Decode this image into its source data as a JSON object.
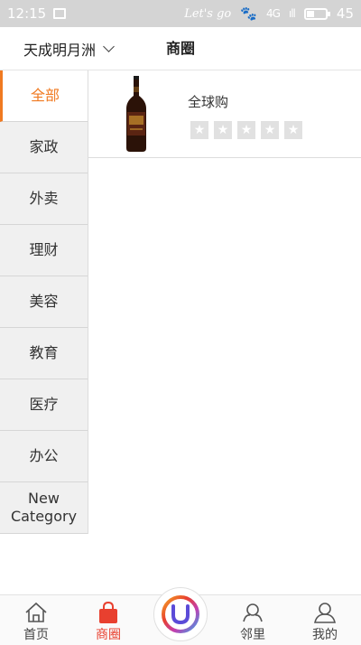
{
  "status_bar": {
    "time": "12:15",
    "carrier_sign": "Let's go",
    "signal_1": "4G",
    "signal_2": "ıll",
    "battery_level": "45",
    "battery_fraction": 0.45
  },
  "header": {
    "location": "天成明月洲",
    "title": "商圈"
  },
  "sidebar": {
    "items": [
      {
        "label": "全部",
        "active": true
      },
      {
        "label": "家政",
        "active": false
      },
      {
        "label": "外卖",
        "active": false
      },
      {
        "label": "理财",
        "active": false
      },
      {
        "label": "美容",
        "active": false
      },
      {
        "label": "教育",
        "active": false
      },
      {
        "label": "医疗",
        "active": false
      },
      {
        "label": "办公",
        "active": false
      },
      {
        "label": "New Category",
        "active": false
      }
    ]
  },
  "list": {
    "items": [
      {
        "name": "全球购",
        "image": "beer-bottle",
        "rating": 0,
        "rating_max": 5
      }
    ]
  },
  "tabbar": {
    "tabs": [
      {
        "label": "首页",
        "icon": "home-icon",
        "active": false
      },
      {
        "label": "商圈",
        "icon": "shopping-bag-icon",
        "active": true
      },
      {
        "label": "邻里",
        "icon": "neighbors-icon",
        "active": false
      },
      {
        "label": "我的",
        "icon": "profile-icon",
        "active": false
      }
    ],
    "center_icon": "u-logo-icon"
  },
  "colors": {
    "accent": "#f07a21",
    "tab_active": "#e8402f",
    "star_empty": "#e1e1e1"
  }
}
